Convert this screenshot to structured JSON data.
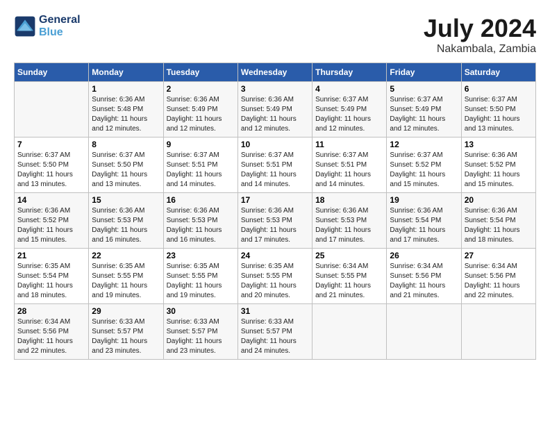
{
  "logo": {
    "text_line1": "General",
    "text_line2": "Blue"
  },
  "title": {
    "month_year": "July 2024",
    "location": "Nakambala, Zambia"
  },
  "days_of_week": [
    "Sunday",
    "Monday",
    "Tuesday",
    "Wednesday",
    "Thursday",
    "Friday",
    "Saturday"
  ],
  "weeks": [
    [
      {
        "day": "",
        "info": ""
      },
      {
        "day": "1",
        "info": "Sunrise: 6:36 AM\nSunset: 5:48 PM\nDaylight: 11 hours\nand 12 minutes."
      },
      {
        "day": "2",
        "info": "Sunrise: 6:36 AM\nSunset: 5:49 PM\nDaylight: 11 hours\nand 12 minutes."
      },
      {
        "day": "3",
        "info": "Sunrise: 6:36 AM\nSunset: 5:49 PM\nDaylight: 11 hours\nand 12 minutes."
      },
      {
        "day": "4",
        "info": "Sunrise: 6:37 AM\nSunset: 5:49 PM\nDaylight: 11 hours\nand 12 minutes."
      },
      {
        "day": "5",
        "info": "Sunrise: 6:37 AM\nSunset: 5:49 PM\nDaylight: 11 hours\nand 12 minutes."
      },
      {
        "day": "6",
        "info": "Sunrise: 6:37 AM\nSunset: 5:50 PM\nDaylight: 11 hours\nand 13 minutes."
      }
    ],
    [
      {
        "day": "7",
        "info": "Sunrise: 6:37 AM\nSunset: 5:50 PM\nDaylight: 11 hours\nand 13 minutes."
      },
      {
        "day": "8",
        "info": "Sunrise: 6:37 AM\nSunset: 5:50 PM\nDaylight: 11 hours\nand 13 minutes."
      },
      {
        "day": "9",
        "info": "Sunrise: 6:37 AM\nSunset: 5:51 PM\nDaylight: 11 hours\nand 14 minutes."
      },
      {
        "day": "10",
        "info": "Sunrise: 6:37 AM\nSunset: 5:51 PM\nDaylight: 11 hours\nand 14 minutes."
      },
      {
        "day": "11",
        "info": "Sunrise: 6:37 AM\nSunset: 5:51 PM\nDaylight: 11 hours\nand 14 minutes."
      },
      {
        "day": "12",
        "info": "Sunrise: 6:37 AM\nSunset: 5:52 PM\nDaylight: 11 hours\nand 15 minutes."
      },
      {
        "day": "13",
        "info": "Sunrise: 6:36 AM\nSunset: 5:52 PM\nDaylight: 11 hours\nand 15 minutes."
      }
    ],
    [
      {
        "day": "14",
        "info": "Sunrise: 6:36 AM\nSunset: 5:52 PM\nDaylight: 11 hours\nand 15 minutes."
      },
      {
        "day": "15",
        "info": "Sunrise: 6:36 AM\nSunset: 5:53 PM\nDaylight: 11 hours\nand 16 minutes."
      },
      {
        "day": "16",
        "info": "Sunrise: 6:36 AM\nSunset: 5:53 PM\nDaylight: 11 hours\nand 16 minutes."
      },
      {
        "day": "17",
        "info": "Sunrise: 6:36 AM\nSunset: 5:53 PM\nDaylight: 11 hours\nand 17 minutes."
      },
      {
        "day": "18",
        "info": "Sunrise: 6:36 AM\nSunset: 5:53 PM\nDaylight: 11 hours\nand 17 minutes."
      },
      {
        "day": "19",
        "info": "Sunrise: 6:36 AM\nSunset: 5:54 PM\nDaylight: 11 hours\nand 17 minutes."
      },
      {
        "day": "20",
        "info": "Sunrise: 6:36 AM\nSunset: 5:54 PM\nDaylight: 11 hours\nand 18 minutes."
      }
    ],
    [
      {
        "day": "21",
        "info": "Sunrise: 6:35 AM\nSunset: 5:54 PM\nDaylight: 11 hours\nand 18 minutes."
      },
      {
        "day": "22",
        "info": "Sunrise: 6:35 AM\nSunset: 5:55 PM\nDaylight: 11 hours\nand 19 minutes."
      },
      {
        "day": "23",
        "info": "Sunrise: 6:35 AM\nSunset: 5:55 PM\nDaylight: 11 hours\nand 19 minutes."
      },
      {
        "day": "24",
        "info": "Sunrise: 6:35 AM\nSunset: 5:55 PM\nDaylight: 11 hours\nand 20 minutes."
      },
      {
        "day": "25",
        "info": "Sunrise: 6:34 AM\nSunset: 5:55 PM\nDaylight: 11 hours\nand 21 minutes."
      },
      {
        "day": "26",
        "info": "Sunrise: 6:34 AM\nSunset: 5:56 PM\nDaylight: 11 hours\nand 21 minutes."
      },
      {
        "day": "27",
        "info": "Sunrise: 6:34 AM\nSunset: 5:56 PM\nDaylight: 11 hours\nand 22 minutes."
      }
    ],
    [
      {
        "day": "28",
        "info": "Sunrise: 6:34 AM\nSunset: 5:56 PM\nDaylight: 11 hours\nand 22 minutes."
      },
      {
        "day": "29",
        "info": "Sunrise: 6:33 AM\nSunset: 5:57 PM\nDaylight: 11 hours\nand 23 minutes."
      },
      {
        "day": "30",
        "info": "Sunrise: 6:33 AM\nSunset: 5:57 PM\nDaylight: 11 hours\nand 23 minutes."
      },
      {
        "day": "31",
        "info": "Sunrise: 6:33 AM\nSunset: 5:57 PM\nDaylight: 11 hours\nand 24 minutes."
      },
      {
        "day": "",
        "info": ""
      },
      {
        "day": "",
        "info": ""
      },
      {
        "day": "",
        "info": ""
      }
    ]
  ]
}
